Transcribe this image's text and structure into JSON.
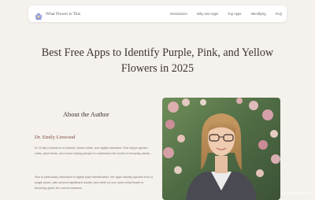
{
  "header": {
    "site_name": "What Flower is This",
    "logo_icon": "flower-icon",
    "nav_links": [
      {
        "label": "Introduction"
      },
      {
        "label": "Why Use Apps"
      },
      {
        "label": "Top Apps"
      },
      {
        "label": "Identifying"
      },
      {
        "label": "FAQ"
      }
    ]
  },
  "main": {
    "title": "Best Free Apps to Identify Purple, Pink, and Yellow Flowers in 2025"
  },
  "author": {
    "section_title": "About the Author",
    "name": "Dr. Emily Linwood",
    "bio_paragraphs": [
      "Dr. Emily Linwood is a botanist, flower writer, and digital naturalist. She enjoys garden visits, plant hunts, and loves helping people to understand the world of everyday plants.",
      "She is particularly interested in digital plant identification: her apps identify species from a single photo, with several significant results, and while no one cares what flower is blooming given the correct answers."
    ],
    "photo_icon": "author-portrait"
  },
  "watermark": "seeropens.co",
  "colors": {
    "background": "#f5f1ec",
    "nav_background": "#ffffff",
    "accent": "#7a4a45",
    "logo_accent": "#8f9bd8"
  }
}
